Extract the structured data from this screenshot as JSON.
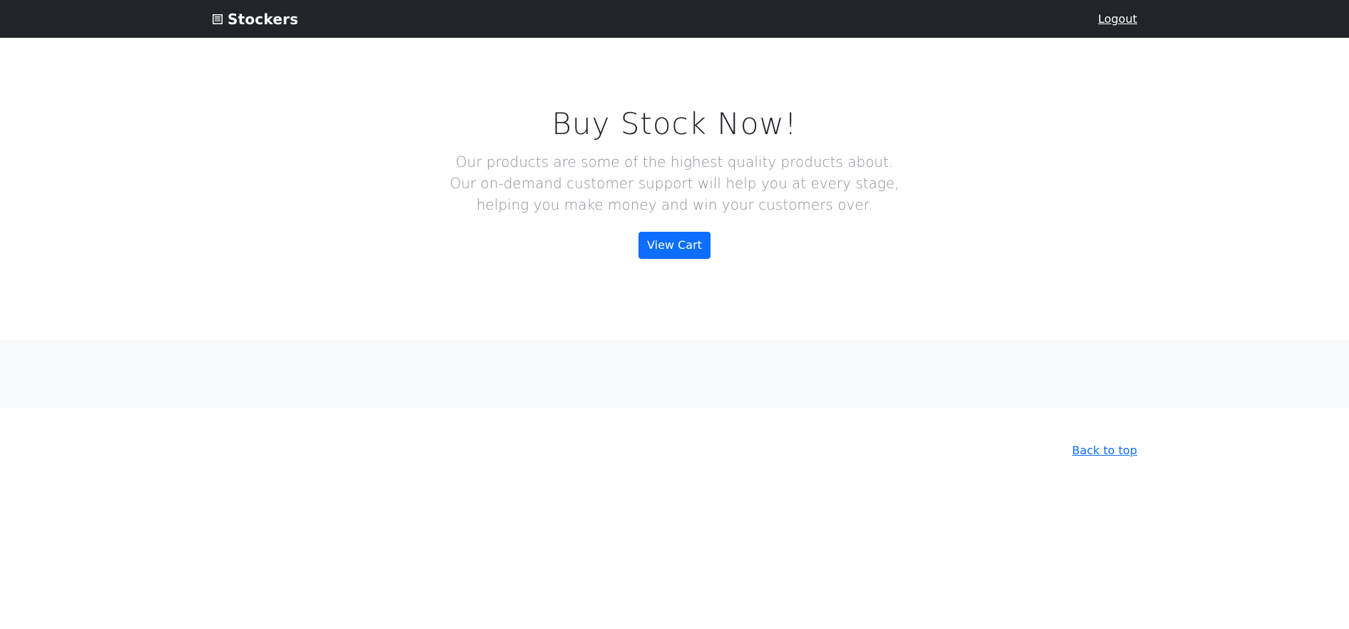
{
  "navbar": {
    "brand_icon": "newspaper-icon",
    "brand": "Stockers",
    "logout": "Logout"
  },
  "hero": {
    "title": "Buy Stock Now!",
    "lead_lines": [
      "Our products are some of the highest quality products about.",
      "Our on-demand customer support will help you at every stage,",
      "helping you make money and win your customers over."
    ],
    "button": "View Cart"
  },
  "footer": {
    "back_to_top": "Back to top"
  },
  "colors": {
    "navbar_bg": "#212529",
    "primary": "#0d6efd",
    "band_bg": "#f8f9fa",
    "lead_text": "#8a9096"
  }
}
